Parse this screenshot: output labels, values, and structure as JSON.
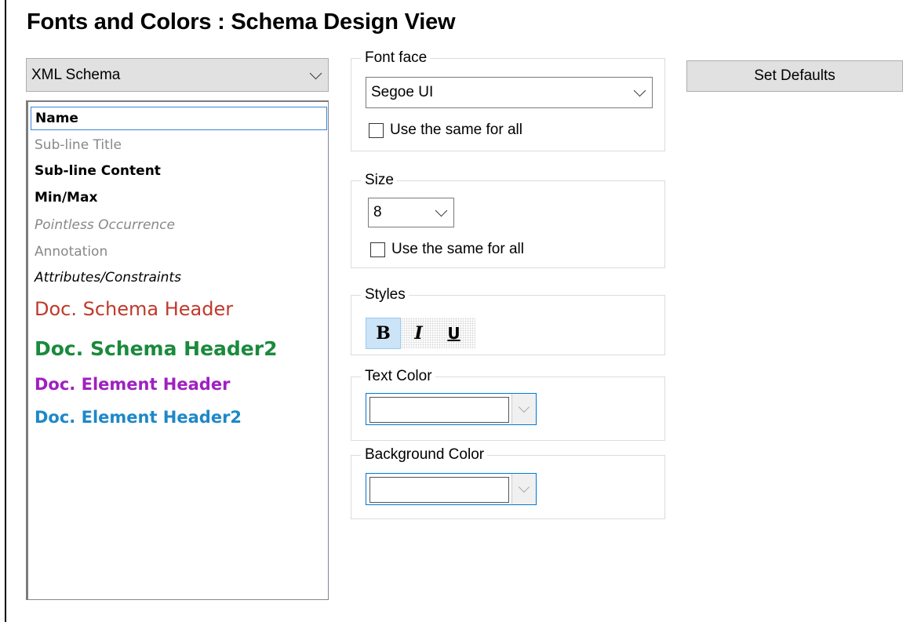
{
  "window": {
    "title": "Fonts and Colors : Schema Design View"
  },
  "schema_select": {
    "value": "XML Schema"
  },
  "items": [
    {
      "label": "Name",
      "color": "#000000"
    },
    {
      "label": "Sub-line Title",
      "color": "#888888"
    },
    {
      "label": "Sub-line Content",
      "color": "#000000"
    },
    {
      "label": "Min/Max",
      "color": "#000000"
    },
    {
      "label": "Pointless Occurrence",
      "color": "#888888"
    },
    {
      "label": "Annotation",
      "color": "#888888"
    },
    {
      "label": "Attributes/Constraints",
      "color": "#000000"
    },
    {
      "label": "Doc. Schema Header",
      "color": "#c0392b"
    },
    {
      "label": "Doc. Schema Header2",
      "color": "#1a8a3c"
    },
    {
      "label": "Doc. Element Header",
      "color": "#a020c0"
    },
    {
      "label": "Doc. Element Header2",
      "color": "#1e88c8"
    }
  ],
  "font_face": {
    "legend": "Font face",
    "value": "Segoe UI",
    "same_for_all": "Use the same for all"
  },
  "size": {
    "legend": "Size",
    "value": "8",
    "same_for_all": "Use the same for all"
  },
  "styles": {
    "legend": "Styles",
    "bold": "B",
    "italic": "I",
    "underline": "U",
    "active": "bold"
  },
  "text_color": {
    "legend": "Text Color"
  },
  "background_color": {
    "legend": "Background Color"
  },
  "buttons": {
    "set_defaults": "Set Defaults"
  },
  "colors": {
    "accent": "#0078d7",
    "selection_border": "#3b84d8"
  }
}
